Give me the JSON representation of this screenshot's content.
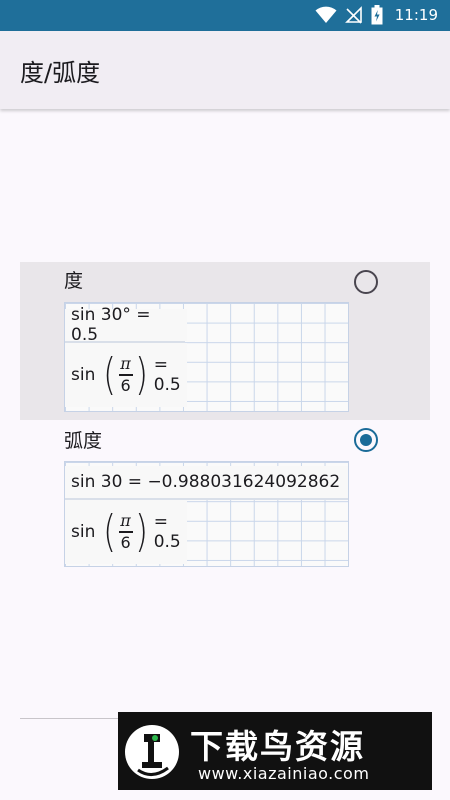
{
  "status_bar": {
    "time": "11:19",
    "icons": [
      "wifi-icon",
      "no-signal-icon",
      "battery-charging-icon"
    ]
  },
  "app_bar": {
    "title": "度/弧度"
  },
  "options": {
    "degree": {
      "label": "度",
      "selected": false,
      "eq1_text": "sin 30° = 0.5",
      "eq2_prefix": "sin",
      "eq2_numerator": "π",
      "eq2_denominator": "6",
      "eq2_result": "= 0.5"
    },
    "radian": {
      "label": "弧度",
      "selected": true,
      "eq1_text": "sin 30 = −0.988031624092862",
      "eq2_prefix": "sin",
      "eq2_numerator": "π",
      "eq2_denominator": "6",
      "eq2_result": "= 0.5"
    }
  },
  "watermark": {
    "title": "下载鸟资源",
    "url": "www.xiazainiao.com"
  },
  "colors": {
    "status_bar": "#1f6f9a",
    "accent": "#1a6b98",
    "selected_bg": "#e9e6ea"
  }
}
